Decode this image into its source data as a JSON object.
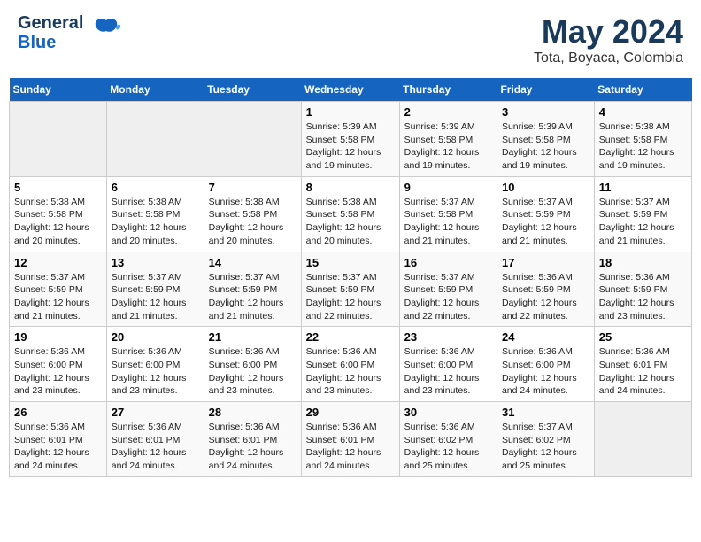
{
  "header": {
    "logo_line1": "General",
    "logo_line2": "Blue",
    "main_title": "May 2024",
    "subtitle": "Tota, Boyaca, Colombia"
  },
  "days_of_week": [
    "Sunday",
    "Monday",
    "Tuesday",
    "Wednesday",
    "Thursday",
    "Friday",
    "Saturday"
  ],
  "weeks": [
    [
      {
        "day": "",
        "info": ""
      },
      {
        "day": "",
        "info": ""
      },
      {
        "day": "",
        "info": ""
      },
      {
        "day": "1",
        "info": "Sunrise: 5:39 AM\nSunset: 5:58 PM\nDaylight: 12 hours\nand 19 minutes."
      },
      {
        "day": "2",
        "info": "Sunrise: 5:39 AM\nSunset: 5:58 PM\nDaylight: 12 hours\nand 19 minutes."
      },
      {
        "day": "3",
        "info": "Sunrise: 5:39 AM\nSunset: 5:58 PM\nDaylight: 12 hours\nand 19 minutes."
      },
      {
        "day": "4",
        "info": "Sunrise: 5:38 AM\nSunset: 5:58 PM\nDaylight: 12 hours\nand 19 minutes."
      }
    ],
    [
      {
        "day": "5",
        "info": "Sunrise: 5:38 AM\nSunset: 5:58 PM\nDaylight: 12 hours\nand 20 minutes."
      },
      {
        "day": "6",
        "info": "Sunrise: 5:38 AM\nSunset: 5:58 PM\nDaylight: 12 hours\nand 20 minutes."
      },
      {
        "day": "7",
        "info": "Sunrise: 5:38 AM\nSunset: 5:58 PM\nDaylight: 12 hours\nand 20 minutes."
      },
      {
        "day": "8",
        "info": "Sunrise: 5:38 AM\nSunset: 5:58 PM\nDaylight: 12 hours\nand 20 minutes."
      },
      {
        "day": "9",
        "info": "Sunrise: 5:37 AM\nSunset: 5:58 PM\nDaylight: 12 hours\nand 21 minutes."
      },
      {
        "day": "10",
        "info": "Sunrise: 5:37 AM\nSunset: 5:59 PM\nDaylight: 12 hours\nand 21 minutes."
      },
      {
        "day": "11",
        "info": "Sunrise: 5:37 AM\nSunset: 5:59 PM\nDaylight: 12 hours\nand 21 minutes."
      }
    ],
    [
      {
        "day": "12",
        "info": "Sunrise: 5:37 AM\nSunset: 5:59 PM\nDaylight: 12 hours\nand 21 minutes."
      },
      {
        "day": "13",
        "info": "Sunrise: 5:37 AM\nSunset: 5:59 PM\nDaylight: 12 hours\nand 21 minutes."
      },
      {
        "day": "14",
        "info": "Sunrise: 5:37 AM\nSunset: 5:59 PM\nDaylight: 12 hours\nand 21 minutes."
      },
      {
        "day": "15",
        "info": "Sunrise: 5:37 AM\nSunset: 5:59 PM\nDaylight: 12 hours\nand 22 minutes."
      },
      {
        "day": "16",
        "info": "Sunrise: 5:37 AM\nSunset: 5:59 PM\nDaylight: 12 hours\nand 22 minutes."
      },
      {
        "day": "17",
        "info": "Sunrise: 5:36 AM\nSunset: 5:59 PM\nDaylight: 12 hours\nand 22 minutes."
      },
      {
        "day": "18",
        "info": "Sunrise: 5:36 AM\nSunset: 5:59 PM\nDaylight: 12 hours\nand 23 minutes."
      }
    ],
    [
      {
        "day": "19",
        "info": "Sunrise: 5:36 AM\nSunset: 6:00 PM\nDaylight: 12 hours\nand 23 minutes."
      },
      {
        "day": "20",
        "info": "Sunrise: 5:36 AM\nSunset: 6:00 PM\nDaylight: 12 hours\nand 23 minutes."
      },
      {
        "day": "21",
        "info": "Sunrise: 5:36 AM\nSunset: 6:00 PM\nDaylight: 12 hours\nand 23 minutes."
      },
      {
        "day": "22",
        "info": "Sunrise: 5:36 AM\nSunset: 6:00 PM\nDaylight: 12 hours\nand 23 minutes."
      },
      {
        "day": "23",
        "info": "Sunrise: 5:36 AM\nSunset: 6:00 PM\nDaylight: 12 hours\nand 23 minutes."
      },
      {
        "day": "24",
        "info": "Sunrise: 5:36 AM\nSunset: 6:00 PM\nDaylight: 12 hours\nand 24 minutes."
      },
      {
        "day": "25",
        "info": "Sunrise: 5:36 AM\nSunset: 6:01 PM\nDaylight: 12 hours\nand 24 minutes."
      }
    ],
    [
      {
        "day": "26",
        "info": "Sunrise: 5:36 AM\nSunset: 6:01 PM\nDaylight: 12 hours\nand 24 minutes."
      },
      {
        "day": "27",
        "info": "Sunrise: 5:36 AM\nSunset: 6:01 PM\nDaylight: 12 hours\nand 24 minutes."
      },
      {
        "day": "28",
        "info": "Sunrise: 5:36 AM\nSunset: 6:01 PM\nDaylight: 12 hours\nand 24 minutes."
      },
      {
        "day": "29",
        "info": "Sunrise: 5:36 AM\nSunset: 6:01 PM\nDaylight: 12 hours\nand 24 minutes."
      },
      {
        "day": "30",
        "info": "Sunrise: 5:36 AM\nSunset: 6:02 PM\nDaylight: 12 hours\nand 25 minutes."
      },
      {
        "day": "31",
        "info": "Sunrise: 5:37 AM\nSunset: 6:02 PM\nDaylight: 12 hours\nand 25 minutes."
      },
      {
        "day": "",
        "info": ""
      }
    ]
  ]
}
